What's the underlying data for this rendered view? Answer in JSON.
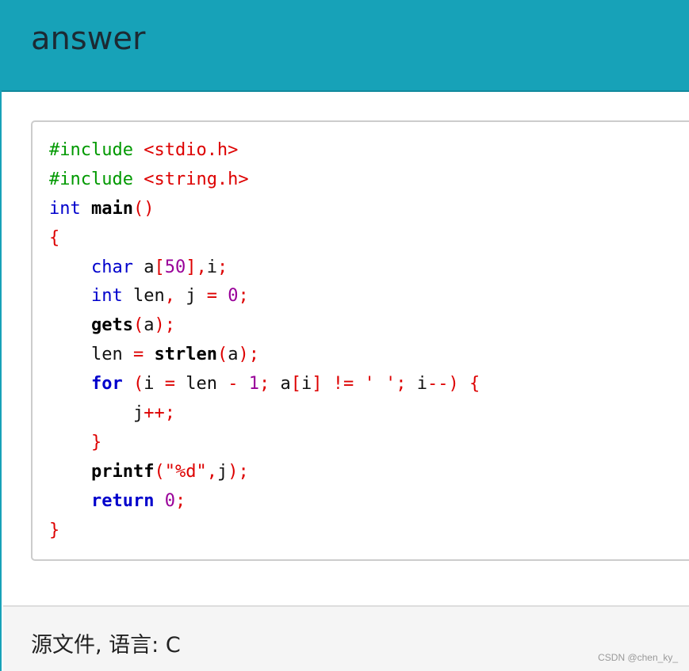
{
  "panel": {
    "title": "answer",
    "code_lines": [
      [
        {
          "t": "#include",
          "c": "pp"
        },
        {
          "t": " ",
          "c": "id"
        },
        {
          "t": "<stdio.h>",
          "c": "str"
        }
      ],
      [
        {
          "t": "#include",
          "c": "pp"
        },
        {
          "t": " ",
          "c": "id"
        },
        {
          "t": "<string.h>",
          "c": "str"
        }
      ],
      [
        {
          "t": "int",
          "c": "ty"
        },
        {
          "t": " ",
          "c": "id"
        },
        {
          "t": "main",
          "c": "fn"
        },
        {
          "t": "()",
          "c": "op"
        }
      ],
      [
        {
          "t": "{",
          "c": "op"
        }
      ],
      [
        {
          "t": "    ",
          "c": "id"
        },
        {
          "t": "char",
          "c": "ty"
        },
        {
          "t": " a",
          "c": "id"
        },
        {
          "t": "[",
          "c": "op"
        },
        {
          "t": "50",
          "c": "num"
        },
        {
          "t": "],",
          "c": "op"
        },
        {
          "t": "i",
          "c": "id"
        },
        {
          "t": ";",
          "c": "op"
        }
      ],
      [
        {
          "t": "    ",
          "c": "id"
        },
        {
          "t": "int",
          "c": "ty"
        },
        {
          "t": " len",
          "c": "id"
        },
        {
          "t": ",",
          "c": "op"
        },
        {
          "t": " j ",
          "c": "id"
        },
        {
          "t": "=",
          "c": "op"
        },
        {
          "t": " ",
          "c": "id"
        },
        {
          "t": "0",
          "c": "num"
        },
        {
          "t": ";",
          "c": "op"
        }
      ],
      [
        {
          "t": "    ",
          "c": "id"
        },
        {
          "t": "gets",
          "c": "fn"
        },
        {
          "t": "(",
          "c": "op"
        },
        {
          "t": "a",
          "c": "id"
        },
        {
          "t": ");",
          "c": "op"
        }
      ],
      [
        {
          "t": "    len ",
          "c": "id"
        },
        {
          "t": "=",
          "c": "op"
        },
        {
          "t": " ",
          "c": "id"
        },
        {
          "t": "strlen",
          "c": "fn"
        },
        {
          "t": "(",
          "c": "op"
        },
        {
          "t": "a",
          "c": "id"
        },
        {
          "t": ");",
          "c": "op"
        }
      ],
      [
        {
          "t": "    ",
          "c": "id"
        },
        {
          "t": "for",
          "c": "kw"
        },
        {
          "t": " ",
          "c": "id"
        },
        {
          "t": "(",
          "c": "op"
        },
        {
          "t": "i ",
          "c": "id"
        },
        {
          "t": "=",
          "c": "op"
        },
        {
          "t": " len ",
          "c": "id"
        },
        {
          "t": "-",
          "c": "op"
        },
        {
          "t": " ",
          "c": "id"
        },
        {
          "t": "1",
          "c": "num"
        },
        {
          "t": ";",
          "c": "op"
        },
        {
          "t": " a",
          "c": "id"
        },
        {
          "t": "[",
          "c": "op"
        },
        {
          "t": "i",
          "c": "id"
        },
        {
          "t": "]",
          "c": "op"
        },
        {
          "t": " ",
          "c": "id"
        },
        {
          "t": "!=",
          "c": "op"
        },
        {
          "t": " ",
          "c": "id"
        },
        {
          "t": "' '",
          "c": "str"
        },
        {
          "t": ";",
          "c": "op"
        },
        {
          "t": " i",
          "c": "id"
        },
        {
          "t": "--) {",
          "c": "op"
        }
      ],
      [
        {
          "t": "        j",
          "c": "id"
        },
        {
          "t": "++;",
          "c": "op"
        }
      ],
      [
        {
          "t": "    ",
          "c": "id"
        },
        {
          "t": "}",
          "c": "op"
        }
      ],
      [
        {
          "t": "    ",
          "c": "id"
        },
        {
          "t": "printf",
          "c": "fn"
        },
        {
          "t": "(",
          "c": "op"
        },
        {
          "t": "\"%d\"",
          "c": "str"
        },
        {
          "t": ",",
          "c": "op"
        },
        {
          "t": "j",
          "c": "id"
        },
        {
          "t": ");",
          "c": "op"
        }
      ],
      [
        {
          "t": "    ",
          "c": "id"
        },
        {
          "t": "return",
          "c": "kw"
        },
        {
          "t": " ",
          "c": "id"
        },
        {
          "t": "0",
          "c": "num"
        },
        {
          "t": ";",
          "c": "op"
        }
      ],
      [
        {
          "t": "}",
          "c": "op"
        }
      ]
    ],
    "footer": "源文件, 语言: C"
  },
  "watermark": "CSDN @chen_ky_",
  "colors": {
    "header_bg": "#17a2b8",
    "preprocessor": "#009900",
    "string": "#dd0000",
    "type": "#0000cc",
    "number": "#990099"
  }
}
